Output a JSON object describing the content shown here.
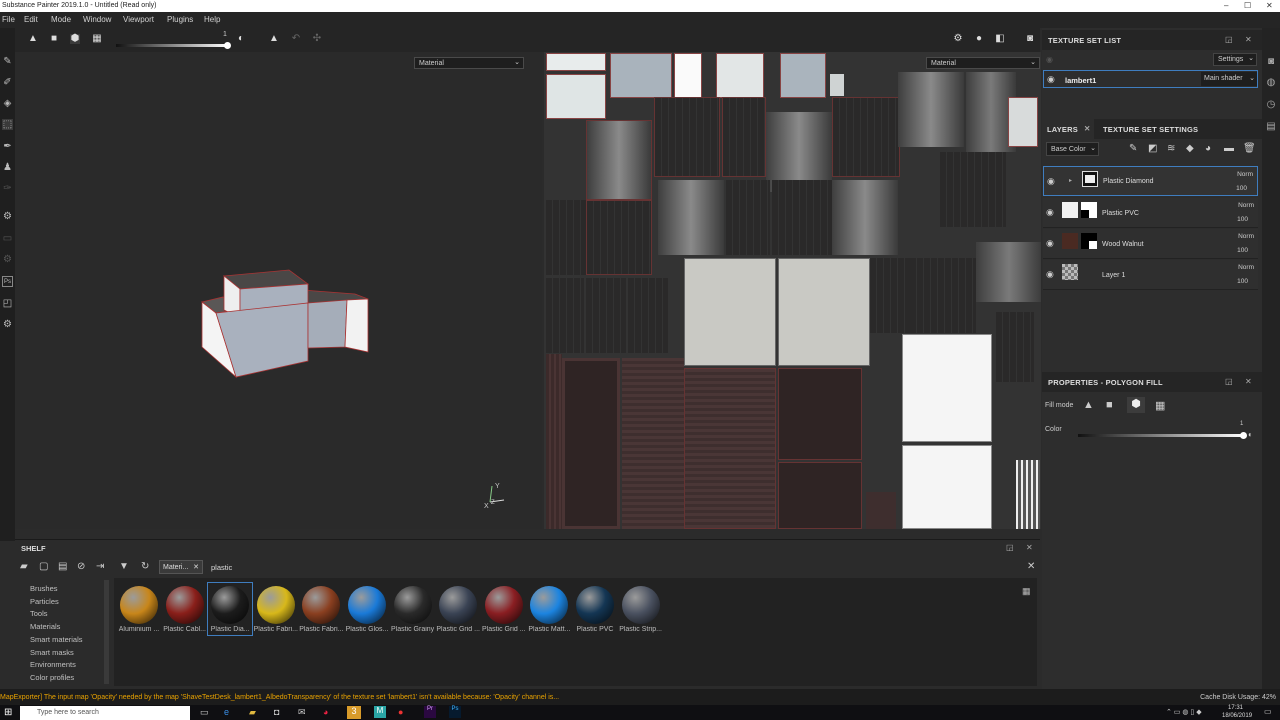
{
  "window": {
    "title": "Substance Painter 2019.1.0 - Untitled (Read only)"
  },
  "menu": [
    "File",
    "Edit",
    "Mode",
    "Window",
    "Viewport",
    "Plugins",
    "Help"
  ],
  "toolbar": {
    "slider_value": "1"
  },
  "viewport3d": {
    "dropdown": "Material"
  },
  "viewport2d": {
    "dropdown": "Material"
  },
  "texture_set_list": {
    "title": "TEXTURE SET LIST",
    "settings_label": "Settings",
    "set_name": "lambert1",
    "shader": "Main shader"
  },
  "layers_panel": {
    "tab_layers": "LAYERS",
    "tab_tss": "TEXTURE SET SETTINGS",
    "channel": "Base Color",
    "layers": [
      {
        "name": "Plastic Diamond",
        "blend": "Norm",
        "opacity": "100"
      },
      {
        "name": "Plastic PVC",
        "blend": "Norm",
        "opacity": "100"
      },
      {
        "name": "Wood Walnut",
        "blend": "Norm",
        "opacity": "100"
      },
      {
        "name": "Layer 1",
        "blend": "Norm",
        "opacity": "100"
      }
    ]
  },
  "properties": {
    "title": "PROPERTIES - POLYGON FILL",
    "fill_mode_label": "Fill mode",
    "color_label": "Color",
    "color_value": "1"
  },
  "shelf": {
    "title": "SHELF",
    "filter_tag": "Materi...",
    "search_value": "plastic",
    "categories": [
      "Brushes",
      "Particles",
      "Tools",
      "Materials",
      "Smart materials",
      "Smart masks",
      "Environments",
      "Color profiles"
    ],
    "materials": [
      {
        "label": "Aluminium ...",
        "color": "#c8861a"
      },
      {
        "label": "Plastic Cabl...",
        "color": "#8a1f1a"
      },
      {
        "label": "Plastic Dia...",
        "color": "#1c1c1c"
      },
      {
        "label": "Plastic Fabri...",
        "color": "#d8b81a"
      },
      {
        "label": "Plastic Fabri...",
        "color": "#8a3f20"
      },
      {
        "label": "Plastic Glos...",
        "color": "#1a7ad8"
      },
      {
        "label": "Plastic Grainy",
        "color": "#2a2a2a"
      },
      {
        "label": "Plastic Grid ...",
        "color": "#3a4354"
      },
      {
        "label": "Plastic Grid ...",
        "color": "#8a1e22"
      },
      {
        "label": "Plastic Matt...",
        "color": "#1c84e0"
      },
      {
        "label": "Plastic PVC",
        "color": "#143654"
      },
      {
        "label": "Plastic Strip...",
        "color": "#4a5160"
      }
    ]
  },
  "status": {
    "message": "MapExporter] The input map 'Opacity' needed by the map 'ShaveTestDesk_lambert1_AlbedoTransparency' of the texture set 'lambert1' isn't available because: 'Opacity' channel is...",
    "cache": "Cache Disk Usage:  42%"
  },
  "taskbar": {
    "search_placeholder": "Type here to search",
    "time": "17:31",
    "date": "18/06/2019"
  }
}
